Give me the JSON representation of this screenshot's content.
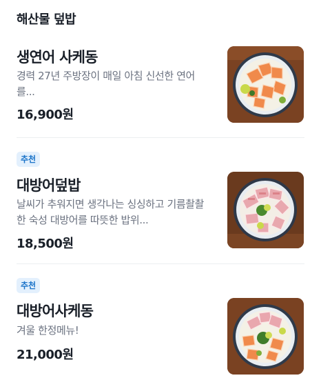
{
  "section": {
    "title": "해산물 덮밥"
  },
  "items": [
    {
      "name": "생연어 사케동",
      "badge": "",
      "description": "경력 27년 주방장이 매일 아침 신선한 연어를...",
      "price": "16,900원",
      "image_icon": "salmon-sake-don-photo"
    },
    {
      "name": "대방어덮밥",
      "badge": "추천",
      "description": "날씨가 추워지면 생각나는 싱싱하고 기름촬촬한 숙성 대방어를 따뜻한 밥위...",
      "price": "18,500원",
      "image_icon": "yellowtail-don-photo"
    },
    {
      "name": "대방어사케동",
      "badge": "추천",
      "description": "겨울 한정메뉴!",
      "price": "21,000원",
      "image_icon": "yellowtail-salmon-don-photo"
    }
  ],
  "colors": {
    "badge_bg": "#e3f0fd",
    "badge_text": "#1a73c9",
    "text_primary": "#191f28",
    "text_secondary": "#6b7280",
    "divider": "#eceef0"
  }
}
